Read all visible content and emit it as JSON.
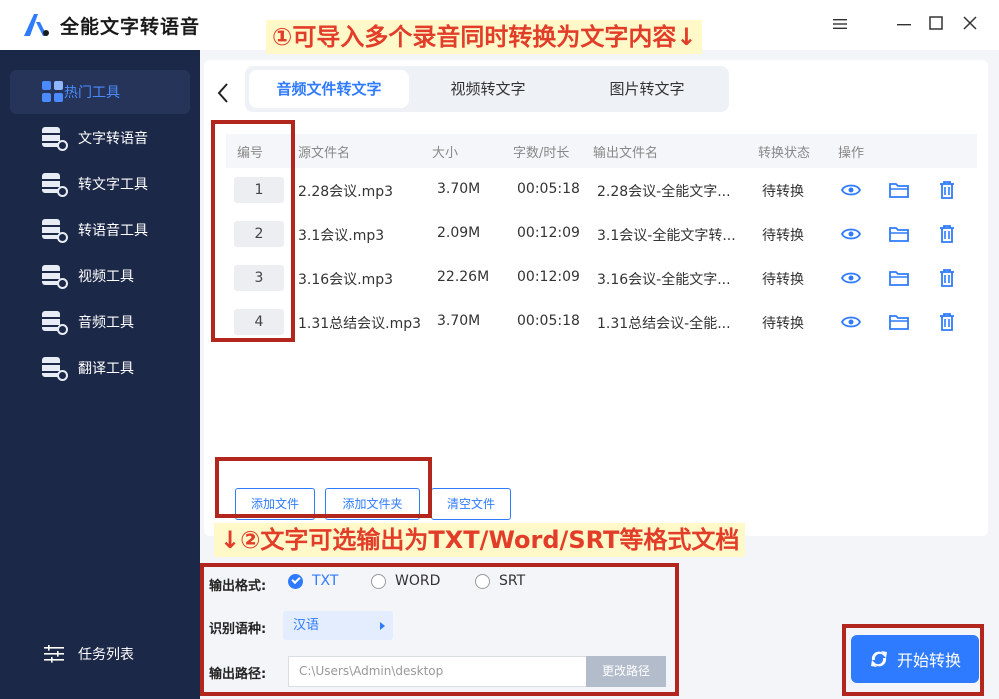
{
  "app": {
    "title": "全能文字转语音",
    "window_controls": [
      "menu",
      "minimize",
      "maximize",
      "close"
    ]
  },
  "callouts": {
    "top": "①可导入多个录音同时转换为文字内容↓",
    "middle": "↓②文字可选输出为TXT/Word/SRT等格式文档"
  },
  "sidebar": {
    "items": [
      {
        "label": "热门工具",
        "icon": "grid-icon",
        "active": true
      },
      {
        "label": "文字转语音",
        "icon": "text-to-speech-icon"
      },
      {
        "label": "转文字工具",
        "icon": "to-text-icon"
      },
      {
        "label": "转语音工具",
        "icon": "to-speech-icon"
      },
      {
        "label": "视频工具",
        "icon": "video-icon"
      },
      {
        "label": "音频工具",
        "icon": "audio-icon"
      },
      {
        "label": "翻译工具",
        "icon": "translate-icon"
      }
    ],
    "task_list": "任务列表"
  },
  "tabs": [
    {
      "label": "音频文件转文字",
      "active": true
    },
    {
      "label": "视频转文字"
    },
    {
      "label": "图片转文字"
    }
  ],
  "table": {
    "headers": [
      "编号",
      "源文件名",
      "大小",
      "字数/时长",
      "输出文件名",
      "转换状态",
      "操作"
    ],
    "rows": [
      {
        "num": "1",
        "name": "2.28会议.mp3",
        "size": "3.70M",
        "duration": "00:05:18",
        "output": "2.28会议-全能文字...",
        "status": "待转换"
      },
      {
        "num": "2",
        "name": "3.1会议.mp3",
        "size": "2.09M",
        "duration": "00:12:09",
        "output": "3.1会议-全能文字转...",
        "status": "待转换"
      },
      {
        "num": "3",
        "name": "3.16会议.mp3",
        "size": "22.26M",
        "duration": "00:12:09",
        "output": "3.16会议-全能文字...",
        "status": "待转换"
      },
      {
        "num": "4",
        "name": "1.31总结会议.mp3",
        "size": "3.70M",
        "duration": "00:05:18",
        "output": "1.31总结会议-全能...",
        "status": "待转换"
      }
    ]
  },
  "buttons": {
    "add_file": "添加文件",
    "add_folder": "添加文件夹",
    "clear": "清空文件",
    "change_path": "更改路径",
    "start": "开始转换"
  },
  "settings": {
    "format_label": "输出格式:",
    "formats": [
      {
        "label": "TXT",
        "checked": true
      },
      {
        "label": "WORD",
        "checked": false
      },
      {
        "label": "SRT",
        "checked": false
      }
    ],
    "lang_label": "识别语种:",
    "lang_value": "汉语",
    "path_label": "输出路径:",
    "path_value": "C:\\Users\\Admin\\desktop"
  },
  "colors": {
    "accent": "#2f7bff",
    "sidebar": "#1c2848",
    "highlight_box": "#b3261e",
    "callout_bg": "#fff8c9",
    "callout_text": "#e23d28"
  }
}
